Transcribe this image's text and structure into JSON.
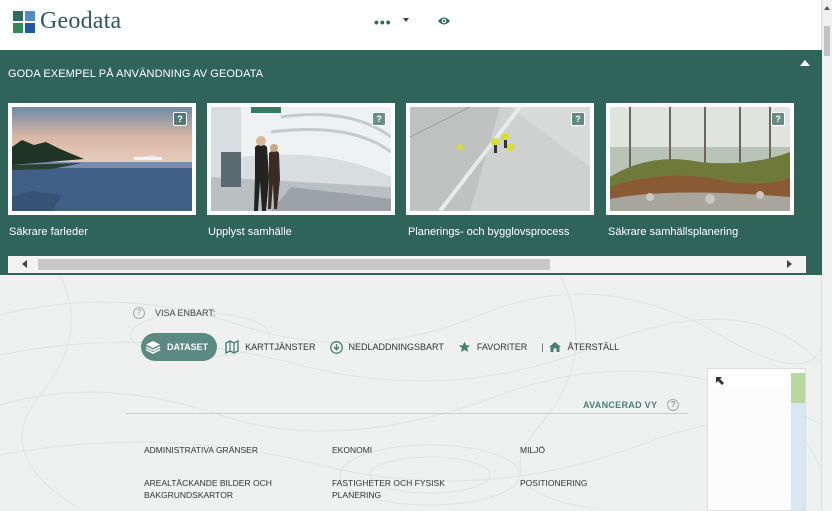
{
  "header": {
    "logo_text": "Geodata",
    "menu_dots": "•••",
    "logo_colors": [
      "#2d6b5e",
      "#4a8fc7",
      "#2e8b57",
      "#1f5a9e"
    ]
  },
  "showcase": {
    "title": "GODA EXEMPEL PÅ ANVÄNDNING AV GEODATA",
    "help_glyph": "?",
    "cards": [
      {
        "label": "Säkrare farleder",
        "image": "archipelago-ship-photo"
      },
      {
        "label": "Upplyst samhälle",
        "image": "metro-tunnel-photo"
      },
      {
        "label": "Planerings- och bygglovsprocess",
        "image": "construction-site-aerial-photo"
      },
      {
        "label": "Säkrare samhällsplanering",
        "image": "forest-slope-photo"
      }
    ]
  },
  "filters": {
    "visa_label": "VISA ENBART:",
    "help_glyph": "?",
    "dataset": "DATASET",
    "karttjanster": "KARTTJÄNSTER",
    "nedladdningsbart": "NEDLADDNINGSBART",
    "favoriter": "FAVORITER",
    "separator": "|",
    "aterstall": "ÅTERSTÄLL"
  },
  "advanced_view": "AVANCERAD VY",
  "categories": [
    [
      "ADMINISTRATIVA GRÄNSER",
      "EKONOMI",
      "MILJÖ"
    ],
    [
      "AREALTÄCKANDE BILDER OCH BAKGRUNDSKARTOR",
      "FASTIGHETER OCH FYSISK PLANERING",
      "POSITIONERING"
    ]
  ],
  "colors": {
    "panel_bg": "#2f6459",
    "accent": "#4a7f73",
    "chip_bg": "#5b8a80"
  }
}
